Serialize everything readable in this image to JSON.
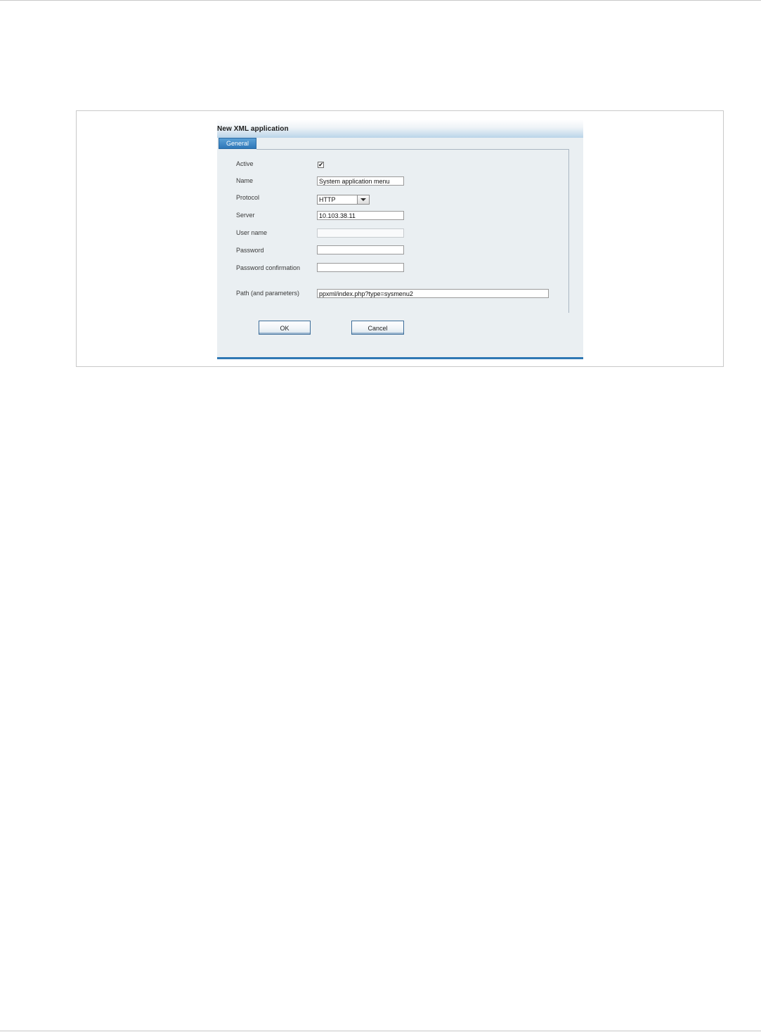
{
  "dialog": {
    "title": "New XML application",
    "tab_general": "General"
  },
  "form": {
    "active_label": "Active",
    "active_checked": true,
    "name_label": "Name",
    "name_value": "System application menu",
    "protocol_label": "Protocol",
    "protocol_value": "HTTP",
    "server_label": "Server",
    "server_value": "10.103.38.11",
    "username_label": "User name",
    "username_value": "",
    "password_label": "Password",
    "password_value": "",
    "password_confirm_label": "Password confirmation",
    "password_confirm_value": "",
    "path_label": "Path (and parameters)",
    "path_value": "ppxml/index.php?type=sysmenu2"
  },
  "buttons": {
    "ok_label": "OK",
    "cancel_label": "Cancel"
  },
  "colors": {
    "tab_accent": "#2e77b8",
    "dialog_background": "#eaeff2"
  },
  "icons": {
    "checkbox_mark": "check-icon",
    "dropdown": "chevron-down-icon"
  }
}
